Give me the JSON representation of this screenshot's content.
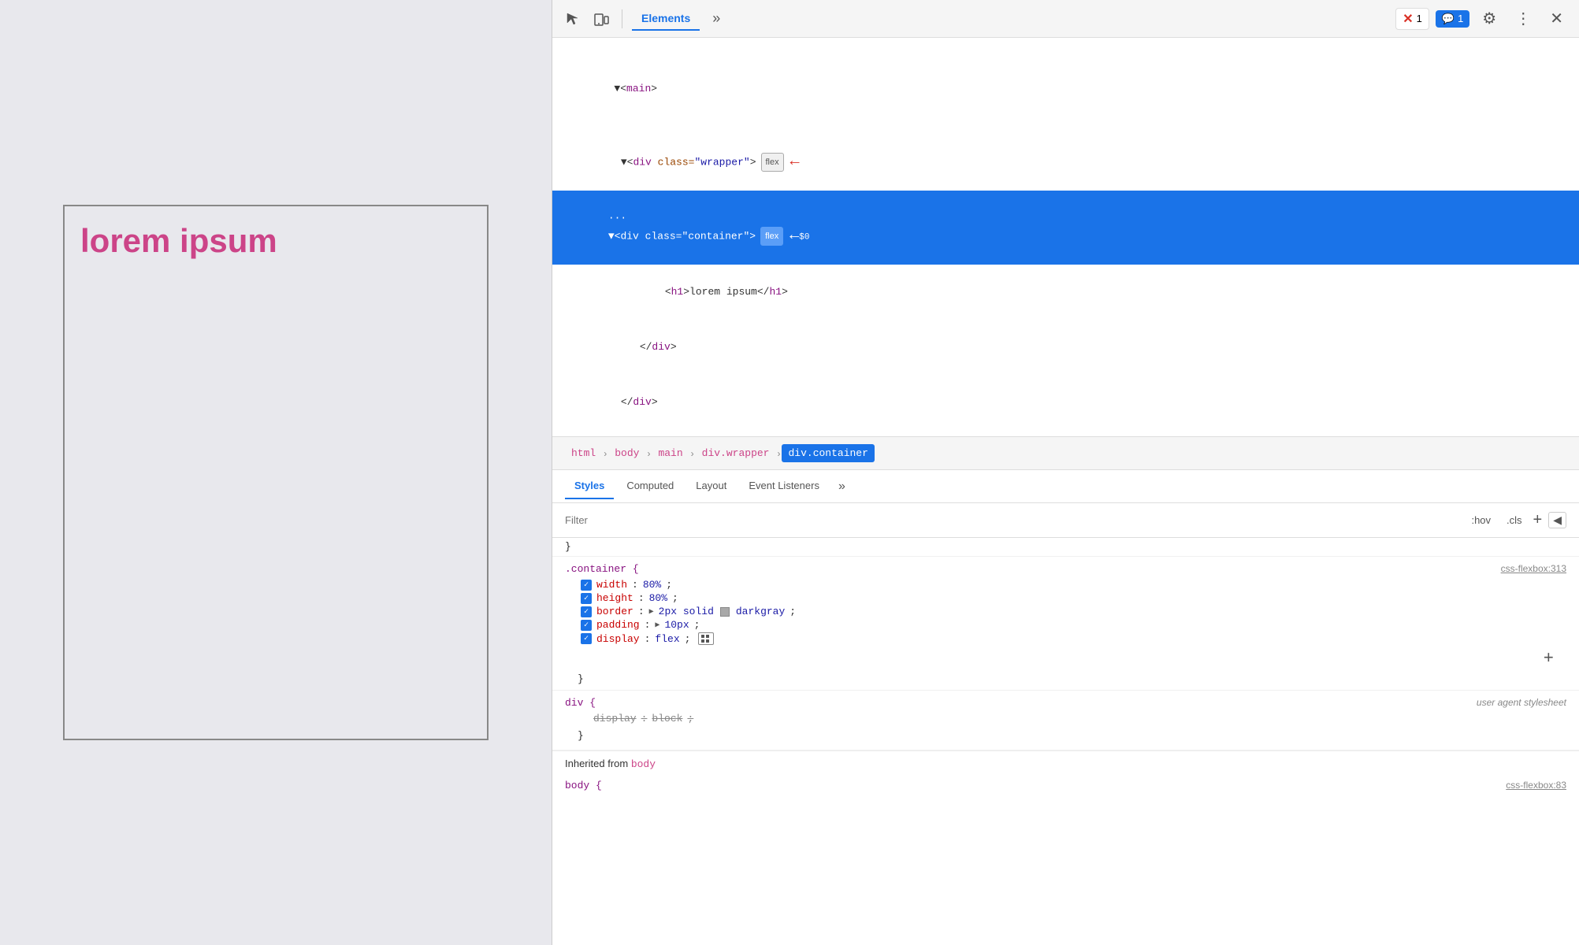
{
  "preview": {
    "lorem_text": "lorem ipsum"
  },
  "devtools": {
    "toolbar": {
      "inspect_label": "inspect",
      "device_label": "device",
      "elements_tab": "Elements",
      "more_label": "»",
      "error_count": "1",
      "message_count": "1",
      "settings_label": "⚙",
      "more_options": "⋮",
      "close_label": "✕"
    },
    "html_tree": {
      "lines": [
        {
          "text": "▼<main>",
          "indent": 0,
          "selected": false
        },
        {
          "text": "▼<div class=\"wrapper\">",
          "indent": 1,
          "selected": false,
          "badge": "flex",
          "arrow": true
        },
        {
          "text": "▼<div class=\"container\">",
          "indent": 2,
          "selected": true,
          "badge": "flex",
          "arrow": true,
          "dots": true
        },
        {
          "text": "<h1>lorem ipsum</h1>",
          "indent": 3,
          "selected": false
        },
        {
          "text": "</div>",
          "indent": 2,
          "selected": false
        },
        {
          "text": "</div>",
          "indent": 1,
          "selected": false
        }
      ]
    },
    "breadcrumbs": [
      {
        "label": "html",
        "active": false
      },
      {
        "label": "body",
        "active": false
      },
      {
        "label": "main",
        "active": false
      },
      {
        "label": "div.wrapper",
        "active": false
      },
      {
        "label": "div.container",
        "active": true
      }
    ],
    "panel_tabs": [
      {
        "label": "Styles",
        "active": true
      },
      {
        "label": "Computed",
        "active": false
      },
      {
        "label": "Layout",
        "active": false
      },
      {
        "label": "Event Listeners",
        "active": false
      },
      {
        "label": "»",
        "active": false
      }
    ],
    "filter": {
      "placeholder": "Filter",
      "hov_label": ":hov",
      "cls_label": ".cls",
      "plus_label": "+",
      "rtl_label": "◀"
    },
    "styles": {
      "container_rule": {
        "selector": ".container {",
        "source": "css-flexbox:313",
        "properties": [
          {
            "name": "width",
            "value": "80%",
            "checked": true
          },
          {
            "name": "height",
            "value": "80%",
            "checked": true
          },
          {
            "name": "border",
            "value": "2px solid darkgray",
            "checked": true,
            "has_color": true
          },
          {
            "name": "padding",
            "value": "10px",
            "checked": true,
            "expandable": true
          },
          {
            "name": "display",
            "value": "flex",
            "checked": true,
            "has_grid_icon": true
          }
        ],
        "close": "}"
      },
      "div_rule": {
        "selector": "div {",
        "source": "user agent stylesheet",
        "properties": [
          {
            "name": "display",
            "value": "block",
            "checked": true,
            "strikethrough": true
          }
        ],
        "close": "}"
      },
      "inherited": {
        "label": "Inherited from",
        "from": "body",
        "source": "css-flexbox:83"
      }
    }
  }
}
